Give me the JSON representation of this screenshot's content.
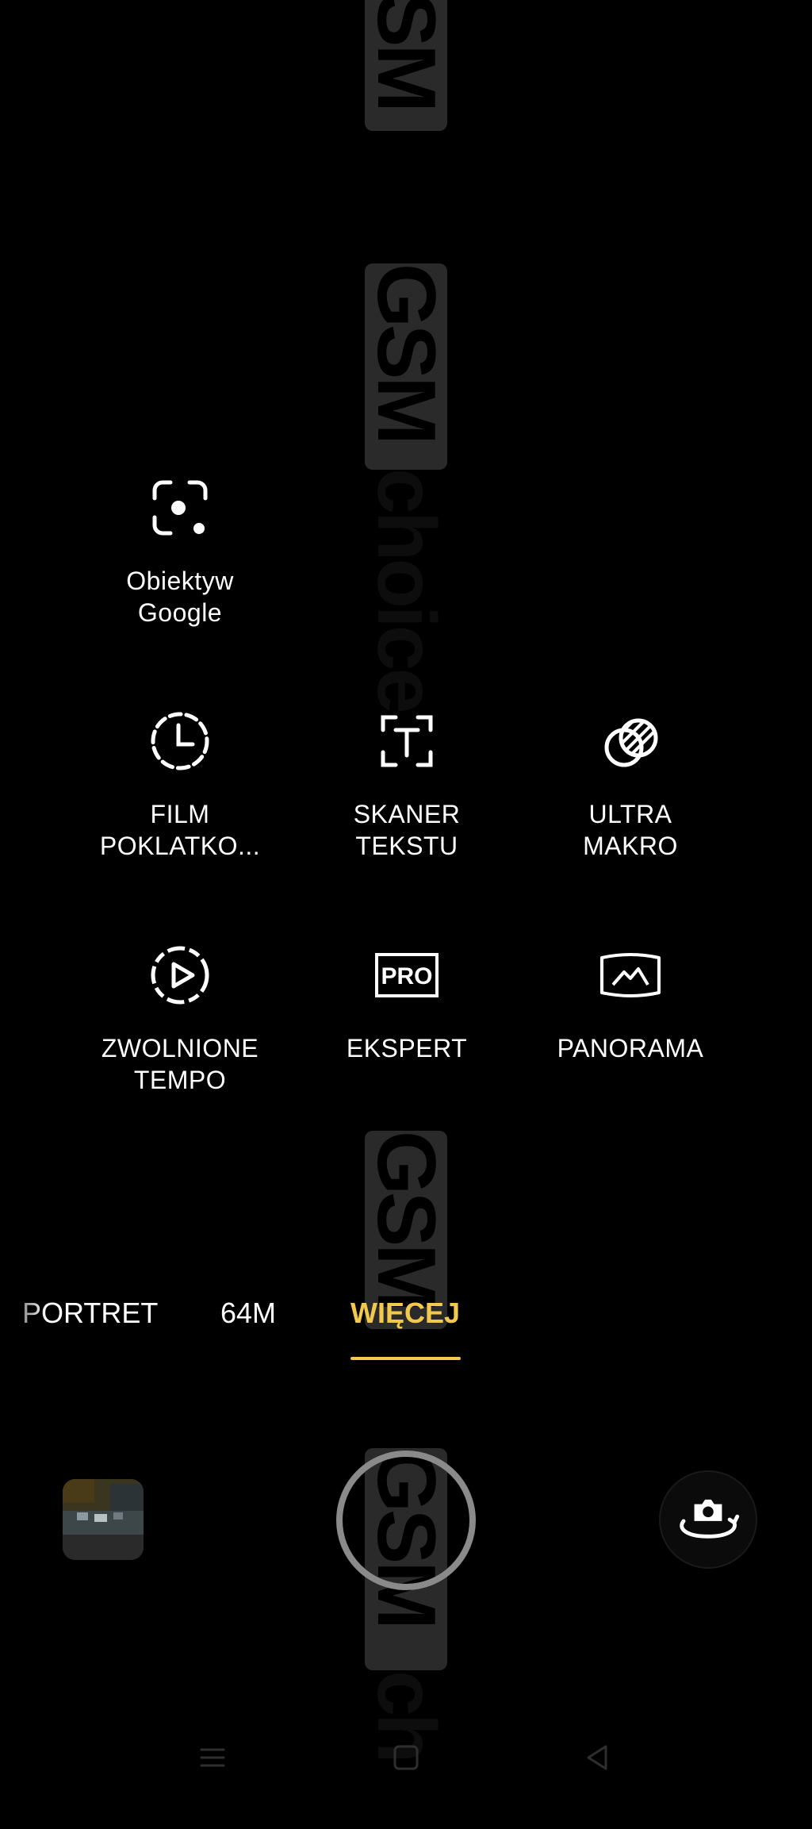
{
  "modes": [
    {
      "label": "Obiektyw\nGoogle",
      "icon": "google-lens-icon"
    },
    {
      "label": "FILM\nPOKLATKO...",
      "icon": "time-lapse-icon"
    },
    {
      "label": "SKANER\nTEKSTU",
      "icon": "text-scanner-icon"
    },
    {
      "label": "ULTRA\nMAKRO",
      "icon": "ultra-macro-icon"
    },
    {
      "label": "ZWOLNIONE\nTEMPO",
      "icon": "slow-motion-icon"
    },
    {
      "label": "EKSPERT",
      "icon": "pro-mode-icon",
      "icon_text": "PRO"
    },
    {
      "label": "PANORAMA",
      "icon": "panorama-icon"
    }
  ],
  "tabs": {
    "portret": "PORTRET",
    "m64": "64M",
    "wiecej": "WIĘCEJ",
    "active": "wiecej"
  },
  "colors": {
    "accent": "#f2c94c",
    "background": "#000000",
    "text": "#ffffff"
  },
  "controls": {
    "gallery_icon": "gallery-thumbnail",
    "shutter_icon": "shutter-button",
    "flip_icon": "camera-flip-icon"
  },
  "navbar": {
    "icons": [
      "menu-icon",
      "home-square-icon",
      "back-triangle-icon"
    ]
  },
  "watermark": "GSMchoice"
}
